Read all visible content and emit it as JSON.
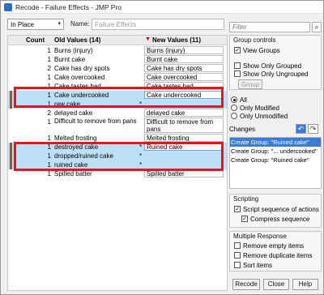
{
  "window": {
    "title": "Recode - Failure Effects - JMP Pro"
  },
  "toolbar": {
    "mode_value": "In Place",
    "name_label": "Name:",
    "name_value": "Failure Effects"
  },
  "grid": {
    "count_header": "Count",
    "old_header": "Old Values (14)",
    "new_header": "New Values (11)",
    "rows": [
      {
        "count": "1",
        "old": "Burns (injury)",
        "star": "",
        "new": "Burns (injury)",
        "selected": false
      },
      {
        "count": "1",
        "old": "Burnt cake",
        "star": "",
        "new": "Burnt cake",
        "selected": false
      },
      {
        "count": "2",
        "old": "Cake has dry spots",
        "star": "",
        "new": "Cake has dry spots",
        "selected": false
      },
      {
        "count": "1",
        "old": "Cake overcooked",
        "star": "",
        "new": "Cake overcooked",
        "selected": false
      },
      {
        "count": "1",
        "old": "Cake tastes bad",
        "star": "",
        "new": "Cake tastes bad",
        "selected": false
      },
      {
        "count": "1",
        "old": "Cake undercooked",
        "star": "",
        "new": "Cake undercooked",
        "selected": true
      },
      {
        "count": "1",
        "old": "raw cake",
        "star": "*",
        "new": "",
        "selected": true
      },
      {
        "count": "2",
        "old": "delayed cake",
        "star": "",
        "new": "delayed cake",
        "selected": false
      },
      {
        "count": "1",
        "old": "Difficult to remove from pans",
        "star": "",
        "new": "Difficult to remove from pans",
        "selected": false,
        "tall": true
      },
      {
        "count": "1",
        "old": "Melted frosting",
        "star": "",
        "new": "Melted frosting",
        "selected": false
      },
      {
        "count": "1",
        "old": "destroyed cake",
        "star": "*",
        "new": "Ruined cake",
        "selected": true
      },
      {
        "count": "1",
        "old": "dropped/ruined cake",
        "star": "*",
        "new": "",
        "selected": true
      },
      {
        "count": "1",
        "old": "ruined cake",
        "star": "*",
        "new": "",
        "selected": true
      },
      {
        "count": "1",
        "old": "Spilled batter",
        "star": "",
        "new": "Spilled batter",
        "selected": false
      }
    ]
  },
  "filter": {
    "placeholder": "Filter",
    "button_icon": "search-icon"
  },
  "group_controls": {
    "title": "Group controls",
    "view_groups": "View Groups",
    "view_groups_checked": true,
    "show_only_grouped": "Show Only Grouped",
    "show_only_ungrouped": "Show Only Ungrouped",
    "group_button": "Group"
  },
  "filter_radios": {
    "all": "All",
    "only_modified": "Only Modified",
    "only_unmodified": "Only Unmodified",
    "selected": "all"
  },
  "changes": {
    "title": "Changes",
    "items": [
      "Create Group: \"Ruined cake\"",
      "Create Group: \"... undercooked\"",
      "Create Group: \"Ruined cake\""
    ]
  },
  "scripting": {
    "title": "Scripting",
    "script_sequence": "Script sequence of actions",
    "compress_sequence": "Compress sequence"
  },
  "multiple_response": {
    "title": "Multiple Response",
    "remove_empty": "Remove empty items",
    "remove_duplicate": "Remove duplicate items",
    "sort_items": "Sort items"
  },
  "buttons": {
    "recode": "Recode",
    "close": "Close",
    "help": "Help"
  },
  "colors": {
    "selection": "#bde0f7",
    "highlight_box": "#e8131b",
    "change_selected": "#3a7bd5"
  }
}
